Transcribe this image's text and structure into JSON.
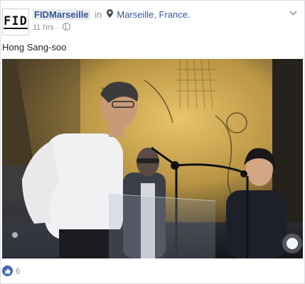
{
  "post": {
    "avatar_text": "FID",
    "page_name": "FIDMarseille",
    "in_word": "in",
    "location": "Marseille, France.",
    "timestamp": "11 hrs",
    "separator": "·",
    "caption": "Hong Sang-soo",
    "reaction_count": "6"
  },
  "icons": {
    "location": "map-pin-icon",
    "privacy": "globe-icon",
    "menu": "chevron-down-icon",
    "reaction": "like-icon"
  },
  "colors": {
    "link": "#365899",
    "meta": "#90949c",
    "like_badge": "#4267b2"
  }
}
